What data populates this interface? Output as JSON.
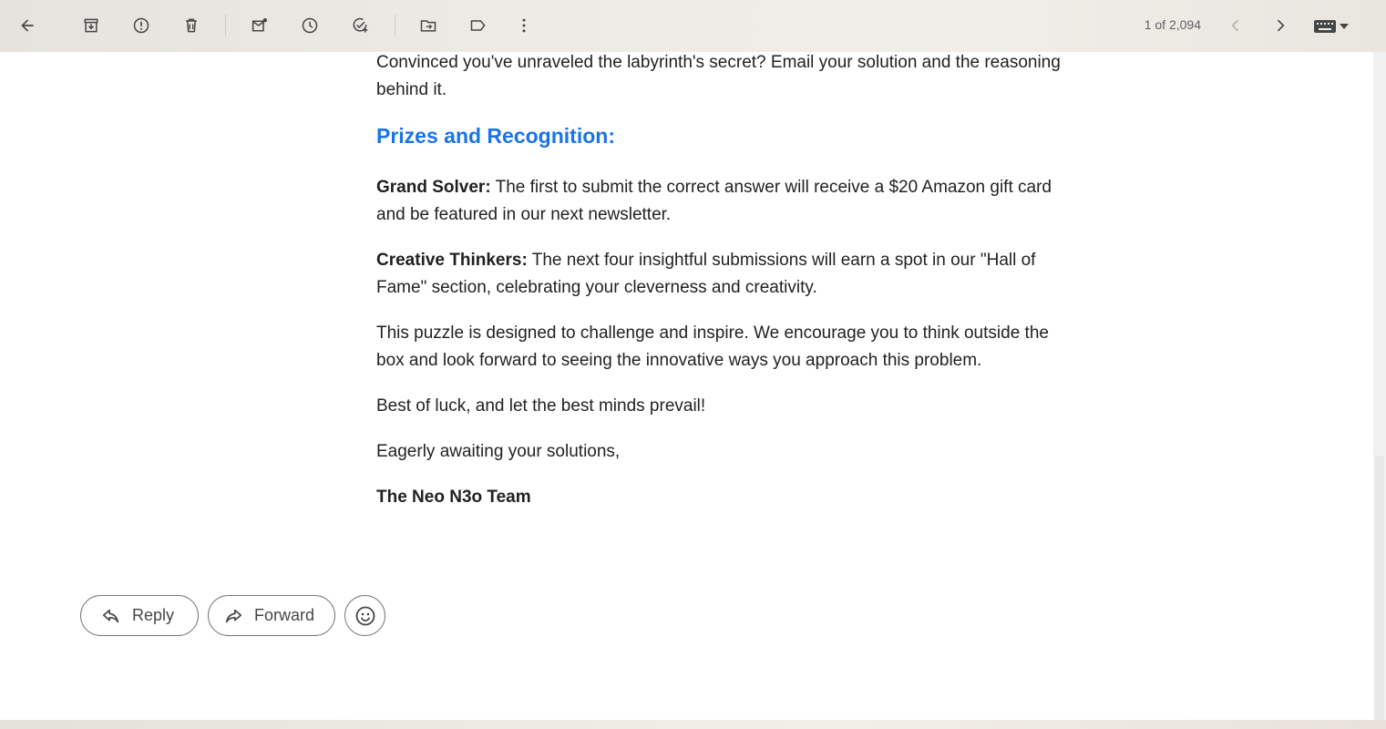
{
  "toolbar": {
    "icons": [
      "back-arrow-icon",
      "archive-icon",
      "report-spam-icon",
      "delete-icon",
      "mark-unread-icon",
      "snooze-icon",
      "add-to-tasks-icon",
      "move-to-icon",
      "label-icon",
      "more-vert-icon"
    ],
    "pager": "1 of 2,094"
  },
  "email": {
    "intro_line": "Convinced you've unraveled the labyrinth's secret? Email your solution and the reasoning behind it.",
    "prizes_heading": "Prizes and Recognition:",
    "prize_1_label": "Grand Solver:",
    "prize_1_text": " The first to submit the correct answer will receive a $20 Amazon gift card and be featured in our next newsletter.",
    "prize_2_label": "Creative Thinkers:",
    "prize_2_text": " The next four insightful submissions will earn a spot in our \"Hall of Fame\" section, celebrating your cleverness and creativity.",
    "challenge_paragraph": "This puzzle is designed to challenge and inspire. We encourage you to think outside the box and look forward to seeing the innovative ways you approach this problem.",
    "good_luck": "Best of luck, and let the best minds prevail!",
    "closing": "Eagerly awaiting your solutions,",
    "signature": "The Neo N3o Team"
  },
  "actions": {
    "reply_label": "Reply",
    "forward_label": "Forward"
  },
  "colors": {
    "heading": "#1a73e8",
    "icon": "#444746"
  }
}
